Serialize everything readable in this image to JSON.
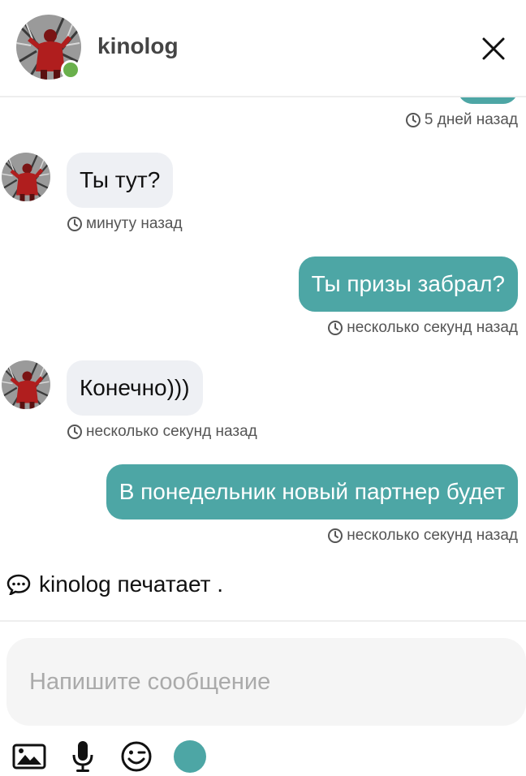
{
  "header": {
    "username": "kinolog",
    "avatar_icon": "user-avatar-photo",
    "online_color": "#6ab04c",
    "close_icon": "close-icon"
  },
  "theme": {
    "accent": "#4da6a5",
    "incoming_bg": "#eef0f4"
  },
  "messages": [
    {
      "direction": "out",
      "text": "",
      "time": "5 дней назад"
    },
    {
      "direction": "in",
      "text": "Ты тут?",
      "time": "минуту назад"
    },
    {
      "direction": "out",
      "text": "Ты призы забрал?",
      "time": "несколько секунд назад"
    },
    {
      "direction": "in",
      "text": "Конечно)))",
      "time": "несколько секунд назад"
    },
    {
      "direction": "out",
      "text": "В понедельник новый партнер будет",
      "time": "несколько секунд назад"
    }
  ],
  "typing": {
    "text": "kinolog печатает ."
  },
  "composer": {
    "placeholder": "Напишите сообщение",
    "value": "",
    "tools": [
      "image-icon",
      "microphone-icon",
      "emoji-wink-icon",
      "send-dot"
    ]
  }
}
